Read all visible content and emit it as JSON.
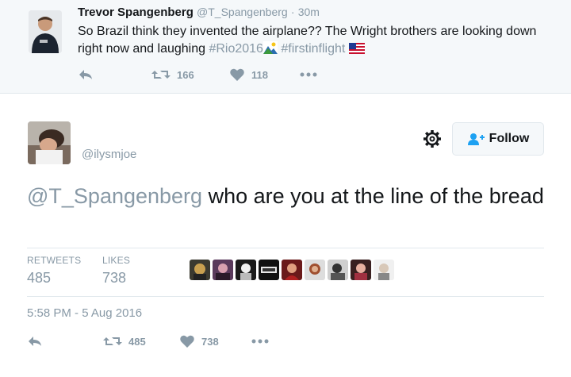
{
  "parent_tweet": {
    "name": "Trevor Spangenberg",
    "handle": "@T_Spangenberg",
    "separator": "·",
    "time": "30m",
    "text_main": "So Brazil think they invented the airplane??  The Wright brothers are looking down right now and laughing ",
    "hashtags": [
      "#Rio2016",
      "#firstinflight"
    ],
    "retweets": "166",
    "likes": "118"
  },
  "main_tweet": {
    "handle": "@ilysmjoe",
    "follow_label": "Follow",
    "mention": "@T_Spangenberg",
    "text": " who are you at the line of the bread",
    "retweets_label": "RETWEETS",
    "retweets": "485",
    "likes_label": "LIKES",
    "likes": "738",
    "timestamp": "5:58 PM - 5 Aug 2016",
    "action_retweets": "485",
    "action_likes": "738"
  },
  "colors": {
    "secondary_text": "#8899a6",
    "parent_bg": "#f5f8fa",
    "divider": "#e1e8ed"
  },
  "icons": [
    "reply-icon",
    "retweet-icon",
    "like-icon",
    "more-icon",
    "gear-icon",
    "follow-person-icon",
    "mountain-emoji-icon",
    "us-flag-emoji-icon"
  ]
}
